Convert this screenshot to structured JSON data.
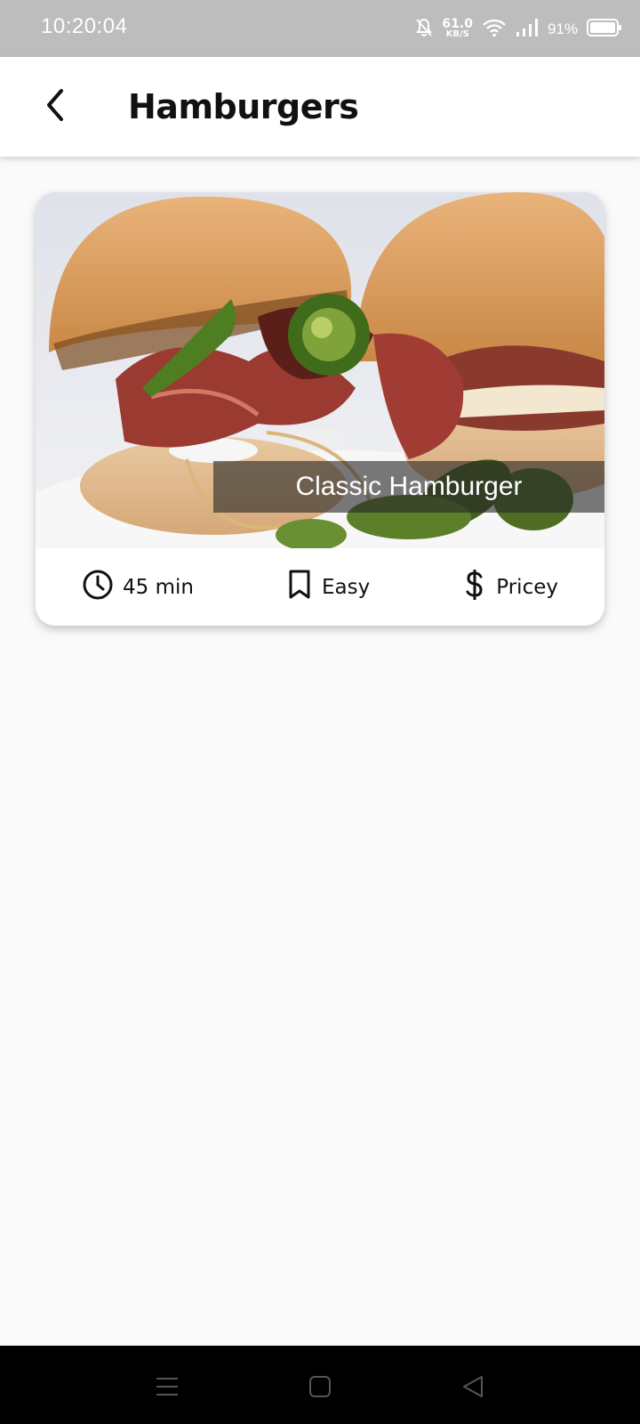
{
  "status_bar": {
    "time": "10:20:04",
    "net_speed_value": "61.0",
    "net_speed_unit": "KB/S",
    "battery": "91%",
    "icons": [
      "bell-off-icon",
      "wifi-icon",
      "signal-icon",
      "battery-icon"
    ]
  },
  "app_bar": {
    "title": "Hamburgers",
    "back_icon": "chevron-left-icon"
  },
  "recipe": {
    "title": "Classic Hamburger",
    "duration": "45 min",
    "complexity": "Easy",
    "affordability": "Pricey",
    "icons": [
      "clock-icon",
      "bookmark-icon",
      "dollar-icon"
    ]
  },
  "system_nav": {
    "icons": [
      "menu-icon",
      "home-icon",
      "back-triangle-icon"
    ]
  },
  "colors": {
    "status_bar": "#bdbdbd",
    "background": "#fafafa",
    "title_band": "#282828"
  }
}
